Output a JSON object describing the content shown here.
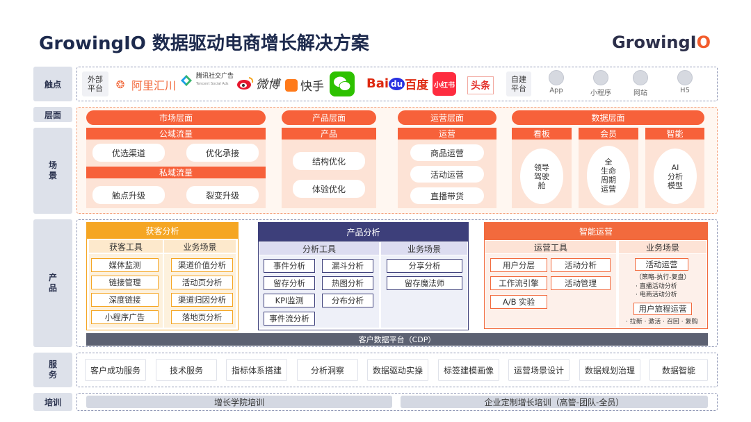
{
  "header": {
    "title": "GrowingIO 数据驱动电商增长解决方案",
    "logo_prefix": "Growing",
    "logo_i": "I",
    "logo_o": "O"
  },
  "rows": {
    "touch": "触点",
    "layer": "层面",
    "scene": "场景",
    "product": "产品",
    "service": "服务",
    "training": "培训"
  },
  "touch": {
    "external_tag": "外部平台",
    "brands": [
      "阿里汇川",
      "腾讯社交广告",
      "Tencent Social Ads",
      "微博",
      "快手",
      "微信",
      "Bai",
      "du",
      "百度",
      "小红书",
      "头条"
    ],
    "owned_tag": "自建平台",
    "platforms": [
      "App",
      "小程序",
      "网站",
      "H5"
    ]
  },
  "scene": {
    "market": {
      "title": "市场层面",
      "public": "公域流量",
      "public_items": [
        "优选渠道",
        "优化承接"
      ],
      "private": "私域流量",
      "private_items": [
        "触点升级",
        "裂变升级"
      ]
    },
    "product": {
      "title": "产品层面",
      "sub": "产品",
      "items": [
        "结构优化",
        "体验优化"
      ]
    },
    "ops": {
      "title": "运营层面",
      "sub": "运营",
      "items": [
        "商品运营",
        "活动运营",
        "直播带货"
      ]
    },
    "data": {
      "title": "数据层面",
      "cols": [
        {
          "sub": "看板",
          "text": "领导驾驶舱"
        },
        {
          "sub": "会员",
          "text": "全生命周期运营"
        },
        {
          "sub": "智能",
          "text": "AI分析模型"
        }
      ]
    }
  },
  "product": {
    "acq": {
      "title": "获客分析",
      "tools_head": "获客工具",
      "scene_head": "业务场景",
      "tools": [
        "媒体监测",
        "链接管理",
        "深度链接",
        "小程序广告"
      ],
      "scenes": [
        "渠道价值分析",
        "活动页分析",
        "渠道归因分析",
        "落地页分析"
      ]
    },
    "ana": {
      "title": "产品分析",
      "tools_head": "分析工具",
      "scene_head": "业务场景",
      "tools": [
        "事件分析",
        "漏斗分析",
        "留存分析",
        "热图分析",
        "KPI监测",
        "分布分析",
        "事件流分析"
      ],
      "scenes": [
        "分享分析",
        "留存魔法师"
      ]
    },
    "smart": {
      "title": "智能运营",
      "tools_head": "运营工具",
      "scene_head": "业务场景",
      "tools": [
        "用户分层",
        "活动分析",
        "工作流引擎",
        "活动管理",
        "A/B 实验"
      ],
      "scene1": "活动运营",
      "notes1": [
        "（策略-执行-复盘）",
        "· 直播活动分析",
        "· 电商活动分析"
      ],
      "scene2": "用户旅程运营",
      "notes2": "· 拉新 · 激活 · 召回 · 复购"
    },
    "cdp": "客户数据平台（CDP）"
  },
  "service": {
    "items": [
      "客户成功服务",
      "技术服务",
      "指标体系搭建",
      "分析洞察",
      "数据驱动实操",
      "标签建模画像",
      "运营场景设计",
      "数据规划治理",
      "数据智能"
    ]
  },
  "training": {
    "items": [
      "增长学院培训",
      "企业定制增长培训（高管-团队-全员）"
    ]
  },
  "colors": {
    "orange": "#f7613a",
    "amber": "#f5a623",
    "navy": "#3d3f7a",
    "gray_side": "#dde1ea"
  }
}
